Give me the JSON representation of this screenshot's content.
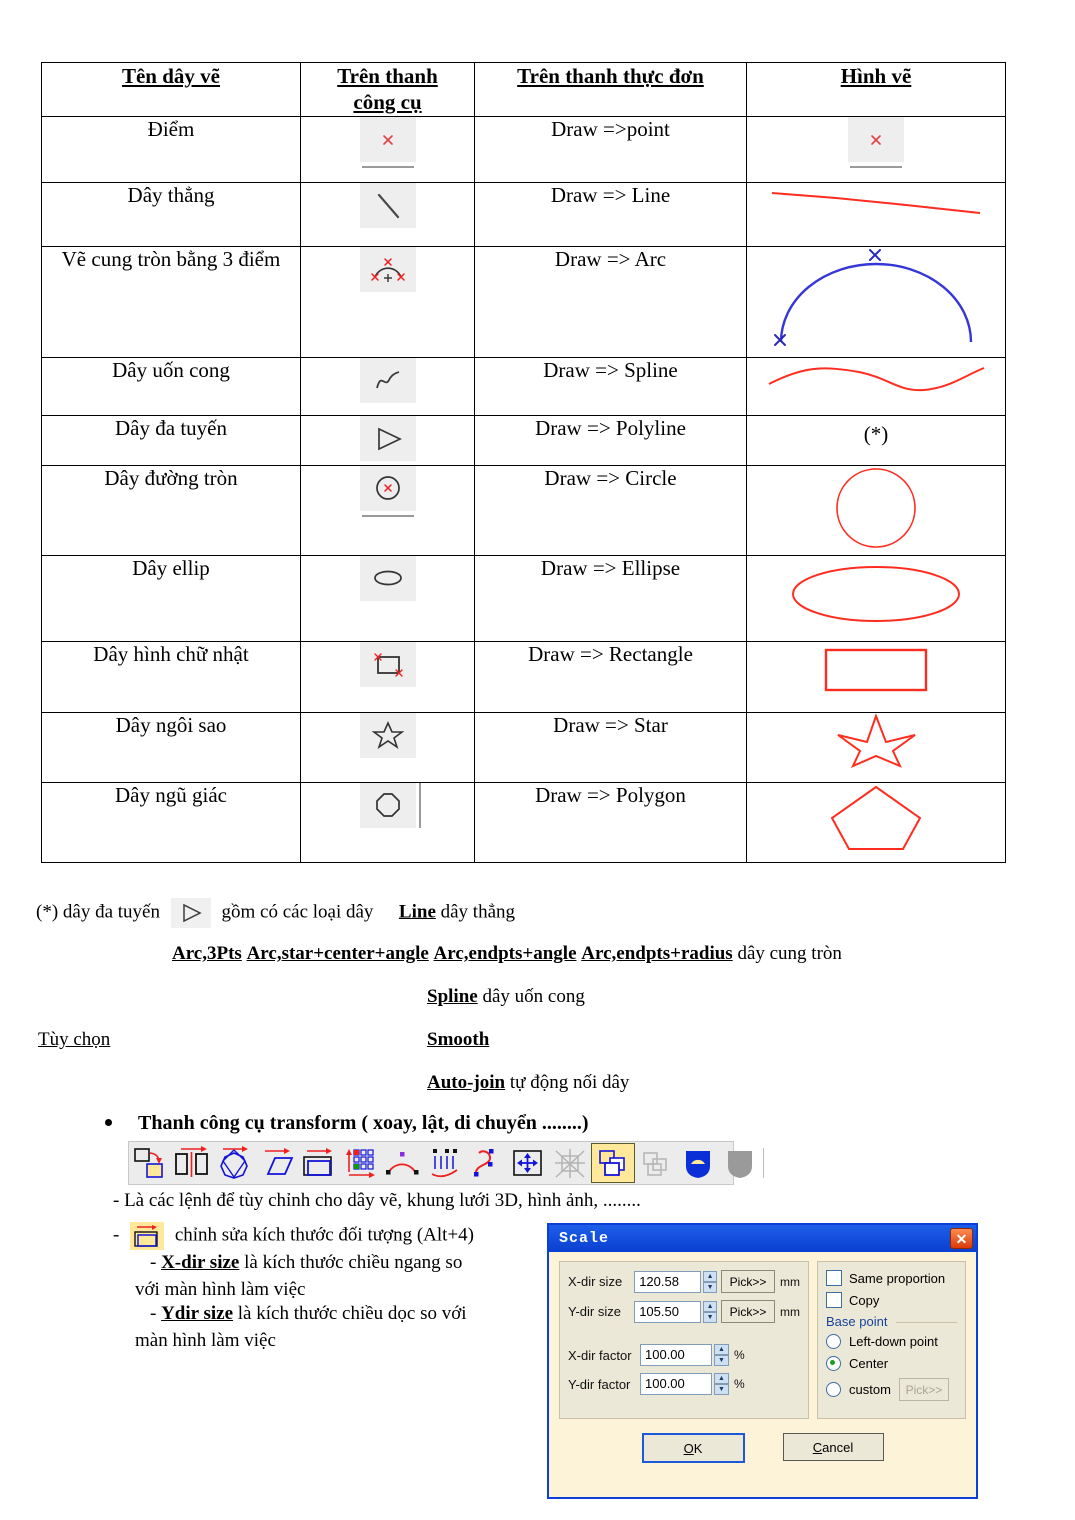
{
  "table": {
    "headers": [
      "Tên dây vẽ",
      "Trên thanh công cụ",
      "Trên thanh thực đơn",
      "Hình vẽ"
    ],
    "header_lines": [
      [
        "Tên dây vẽ"
      ],
      [
        "Trên thanh",
        "công cụ"
      ],
      [
        "Trên thanh thực đơn"
      ],
      [
        "Hình vẽ"
      ]
    ],
    "rows": [
      {
        "name": "Điểm",
        "toolbar_icon": "point-icon",
        "menu": "Draw =>point",
        "figure": "point-figure"
      },
      {
        "name": "Dây thẳng",
        "toolbar_icon": "line-icon",
        "menu": "Draw => Line",
        "figure": "line-figure"
      },
      {
        "name": "Vẽ cung tròn bằng 3 điểm",
        "toolbar_icon": "arc-3pts-icon",
        "menu": "Draw => Arc",
        "figure": "arc-figure"
      },
      {
        "name": "Dây uốn cong",
        "toolbar_icon": "spline-icon",
        "menu": "Draw => Spline",
        "figure": "spline-figure"
      },
      {
        "name": "Dây đa tuyến",
        "toolbar_icon": "polyline-icon",
        "menu": "Draw => Polyline",
        "figure": "(*)"
      },
      {
        "name": "Dây đường tròn",
        "toolbar_icon": "circle-icon",
        "menu": "Draw => Circle",
        "figure": "circle-figure"
      },
      {
        "name": "Dây ellip",
        "toolbar_icon": "ellipse-icon",
        "menu": "Draw => Ellipse",
        "figure": "ellipse-figure"
      },
      {
        "name": "Dây hình chữ nhật",
        "toolbar_icon": "rectangle-icon",
        "menu": "Draw => Rectangle",
        "figure": "rectangle-figure"
      },
      {
        "name": "Dây ngôi sao",
        "toolbar_icon": "star-icon",
        "menu": "Draw => Star",
        "figure": "star-figure"
      },
      {
        "name": "Dây ngũ giác",
        "toolbar_icon": "polygon-icon",
        "menu": "Draw => Polygon",
        "figure": "pentagon-figure"
      }
    ]
  },
  "notes": {
    "polyline_prefix": "(*) dây đa tuyến",
    "polyline_suffix": "gồm có các loại dây",
    "line_kw": "Line",
    "line_desc": "dây thẳng",
    "arc_kw_1": "Arc,3Pts",
    "arc_kw_2": "Arc,star+center+angle",
    "arc_kw_3": "Arc,endpts+angle",
    "arc_kw_4": "Arc,endpts+radius",
    "arc_desc": "dây cung tròn",
    "spline_kw": "Spline",
    "spline_desc": "dây uốn cong",
    "options_label": "Tùy chọn",
    "smooth_kw": "Smooth",
    "autojoin_kw": "Auto-join",
    "autojoin_desc": "tự động nối dây"
  },
  "transform": {
    "heading": "Thanh công cụ transform ( xoay, lật, di chuyển ........)",
    "desc": "- Là các lệnh để tùy chỉnh cho dây vẽ, khung lưới 3D, hình ảnh, ........",
    "scale_line_prefix": "-",
    "scale_line": "chỉnh sửa kích thước đối tượng (Alt+4)",
    "xdir_kw": "X-dir  size",
    "xdir_desc": "là kích thước chiều ngang so",
    "xdir_desc2": "với màn hình làm việc",
    "ydir_kw": "Ydir  size",
    "ydir_desc": "là kích thước chiều dọc so với",
    "ydir_desc2": "màn hình làm việc",
    "dash": "-",
    "toolbar_icons": [
      "rotate-copy-icon",
      "mirror-vertical-icon",
      "rotate-shape-icon",
      "shear-icon",
      "scale-icon",
      "array-icon",
      "arc-deform-icon",
      "wave-deform-icon",
      "path-deform-icon",
      "move-icon",
      "grid-deform-icon",
      "arrange-front-icon",
      "arrange-back-icon",
      "fill-blue-icon",
      "fill-grey-icon"
    ]
  },
  "dialog": {
    "title": "Scale",
    "close_label": "✕",
    "fields": [
      {
        "label": "X-dir size",
        "value": "120.58",
        "button": "Pick>>",
        "unit": "mm",
        "disabled": false
      },
      {
        "label": "Y-dir size",
        "value": "105.50",
        "button": "Pick>>",
        "unit": "mm",
        "disabled": false
      },
      {
        "label": "X-dir factor",
        "value": "100.00",
        "button": "",
        "unit": "%",
        "disabled": false
      },
      {
        "label": "Y-dir factor",
        "value": "100.00",
        "button": "",
        "unit": "%",
        "disabled": false
      }
    ],
    "checkboxes": [
      {
        "label": "Same proportion",
        "checked": false
      },
      {
        "label": "Copy",
        "checked": false
      }
    ],
    "base_point_legend": "Base point",
    "radios": [
      {
        "label": "Left-down point",
        "checked": false
      },
      {
        "label": "Center",
        "checked": true
      },
      {
        "label": "custom",
        "checked": false
      }
    ],
    "custom_pick": "Pick>>",
    "ok": "OK",
    "cancel": "Cancel",
    "colors": {
      "titlebar": "#0b46d6",
      "body": "#fdf3d8",
      "group": "#ece8d8",
      "accent": "#17439b"
    }
  }
}
